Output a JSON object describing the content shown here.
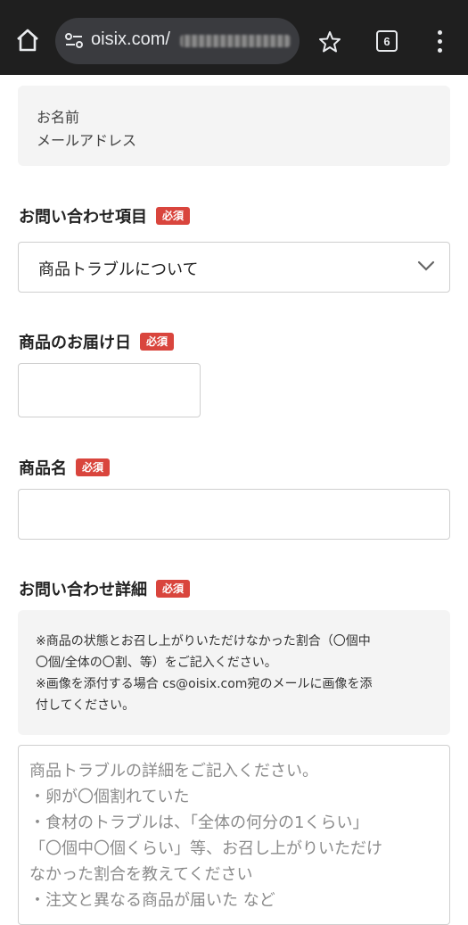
{
  "browser": {
    "url_text": "oisix.com/",
    "tab_count": "6"
  },
  "profile": {
    "name_label": "お名前",
    "email_label": "メールアドレス"
  },
  "form": {
    "inquiry_item": {
      "label": "お問い合わせ項目",
      "required": "必須",
      "selected": "商品トラブルについて"
    },
    "delivery_date": {
      "label": "商品のお届け日",
      "required": "必須",
      "value": ""
    },
    "product_name": {
      "label": "商品名",
      "required": "必須",
      "value": ""
    },
    "detail": {
      "label": "お問い合わせ詳細",
      "required": "必須",
      "notice": [
        "※商品の状態とお召し上がりいただけなかった割合（〇個中",
        "〇個/全体の〇割、等）をご記入ください。",
        "※画像を添付する場合 cs@oisix.com宛のメールに画像を添",
        "付してください。"
      ],
      "placeholder": [
        "商品トラブルの詳細をご記入ください。",
        "・卵が〇個割れていた",
        "・食材のトラブルは、「全体の何分の1くらい」",
        "「〇個中〇個くらい」等、お召し上がりいただけ",
        "なかった割合を教えてください",
        "・注文と異なる商品が届いた など"
      ]
    }
  },
  "colors": {
    "badge": "#d9453d",
    "chrome_bg": "#1f1f1f"
  }
}
